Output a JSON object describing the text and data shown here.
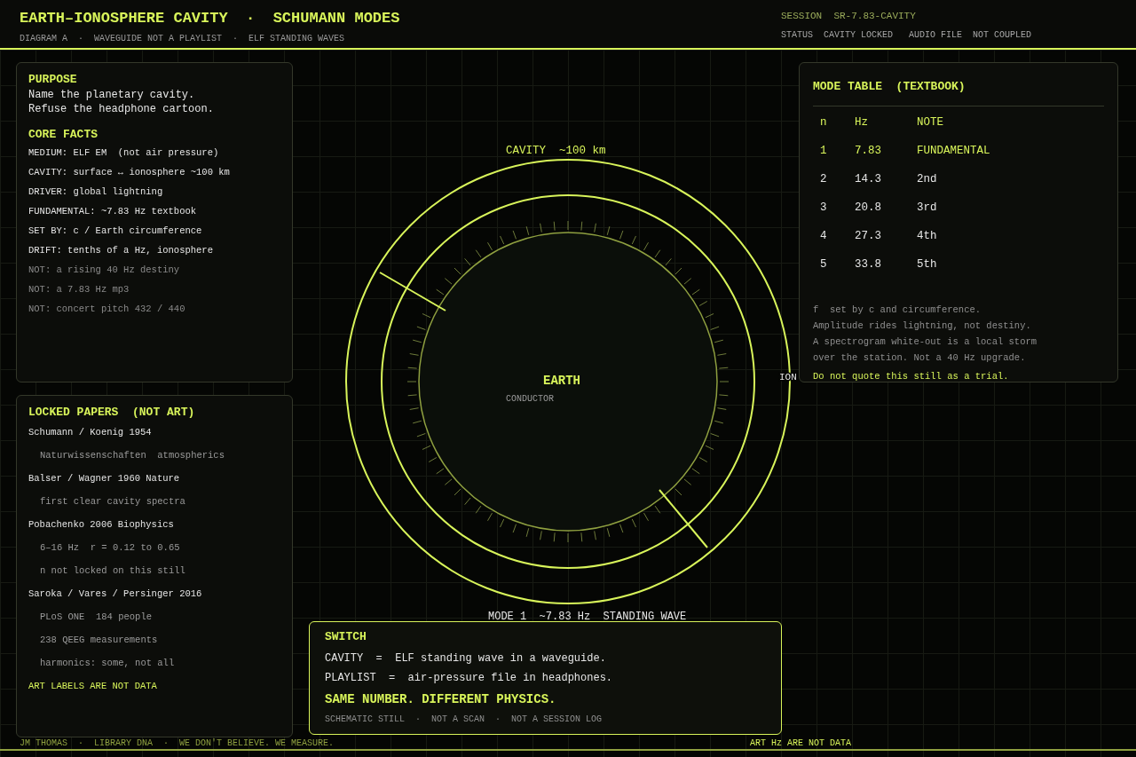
{
  "header": {
    "title": "EARTH–IONOSPHERE CAVITY  ·  SCHUMANN MODES",
    "subtitle": "DIAGRAM A  ·  WAVEGUIDE NOT A PLAYLIST  ·  ELF STANDING WAVES",
    "session": "SESSION  SR-7.83-CAVITY",
    "status": "STATUS  CAVITY LOCKED   AUDIO FILE  NOT COUPLED"
  },
  "purpose": {
    "title": "PURPOSE",
    "lines": [
      "Name the planetary cavity.",
      "Refuse the headphone cartoon."
    ]
  },
  "core_facts": {
    "title": "CORE FACTS",
    "items": [
      {
        "text": "MEDIUM: ELF EM  (not air pressure)",
        "kind": "fact"
      },
      {
        "text": "CAVITY: surface ↔ ionosphere ~100 km",
        "kind": "fact"
      },
      {
        "text": "DRIVER: global lightning",
        "kind": "fact"
      },
      {
        "text": "FUNDAMENTAL: ~7.83 Hz textbook",
        "kind": "fact"
      },
      {
        "text": "SET BY: c / Earth circumference",
        "kind": "fact"
      },
      {
        "text": "DRIFT: tenths of a Hz, ionosphere",
        "kind": "fact"
      },
      {
        "text": "NOT: a rising 40 Hz destiny",
        "kind": "not"
      },
      {
        "text": "NOT: a 7.83 Hz mp3",
        "kind": "not"
      },
      {
        "text": "NOT: concert pitch 432 / 440",
        "kind": "not"
      }
    ]
  },
  "locked_papers": {
    "title": "LOCKED PAPERS  (NOT ART)",
    "items": [
      {
        "text": "Schumann / Koenig 1954",
        "kind": "paper"
      },
      {
        "text": "Naturwissenschaften  atmospherics",
        "kind": "detail"
      },
      {
        "text": "Balser / Wagner 1960 Nature",
        "kind": "paper"
      },
      {
        "text": "first clear cavity spectra",
        "kind": "detail"
      },
      {
        "text": "Pobachenko 2006 Biophysics",
        "kind": "paper"
      },
      {
        "text": "6–16 Hz  r = 0.12 to 0.65",
        "kind": "detail"
      },
      {
        "text": "n not locked on this still",
        "kind": "detail"
      },
      {
        "text": "Saroka / Vares / Persinger 2016",
        "kind": "paper"
      },
      {
        "text": "PLoS ONE  184 people",
        "kind": "detail"
      },
      {
        "text": "238 QEEG measurements",
        "kind": "detail"
      },
      {
        "text": "harmonics: some, not all",
        "kind": "detail"
      },
      {
        "text": "ART LABELS ARE NOT DATA",
        "kind": "warning"
      }
    ]
  },
  "diagram": {
    "cavity_label": "CAVITY  ~100 km",
    "earth_label": "EARTH",
    "earth_sublabel": "CONDUCTOR",
    "ionosphere_label": "ION",
    "mode_label": "MODE 1  ~7.83 Hz  STANDING WAVE"
  },
  "mode_table": {
    "title": "MODE TABLE  (TEXTBOOK)",
    "columns": [
      "n",
      "Hz",
      "NOTE"
    ],
    "rows": [
      {
        "n": "1",
        "hz": "7.83",
        "note": "FUNDAMENTAL",
        "highlighted": true
      },
      {
        "n": "2",
        "hz": "14.3",
        "note": "2nd",
        "highlighted": false
      },
      {
        "n": "3",
        "hz": "20.8",
        "note": "3rd",
        "highlighted": false
      },
      {
        "n": "4",
        "hz": "27.3",
        "note": "4th",
        "highlighted": false
      },
      {
        "n": "5",
        "hz": "33.8",
        "note": "5th",
        "highlighted": false
      }
    ],
    "notes": [
      {
        "text": "f  set by c and circumference.",
        "kind": "note"
      },
      {
        "text": "Amplitude rides lightning, not destiny.",
        "kind": "note"
      },
      {
        "text": "A spectrogram white-out is a local storm",
        "kind": "note"
      },
      {
        "text": "over the station. Not a 40 Hz upgrade.",
        "kind": "note"
      },
      {
        "text": "Do not quote this still as a trial.",
        "kind": "warning"
      }
    ]
  },
  "switch": {
    "title": "SWITCH",
    "lines": [
      "CAVITY  =  ELF standing wave in a waveguide.",
      "PLAYLIST  =  air-pressure file in headphones."
    ],
    "tagline": "SAME NUMBER. DIFFERENT PHYSICS.",
    "footnote": "SCHEMATIC STILL  ·  NOT A SCAN  ·  NOT A SESSION LOG"
  },
  "footer": {
    "left": "JM THOMAS  ·  LIBRARY DNA  ·  WE DON'T BELIEVE. WE MEASURE.",
    "right": "ART Hz ARE NOT DATA"
  }
}
